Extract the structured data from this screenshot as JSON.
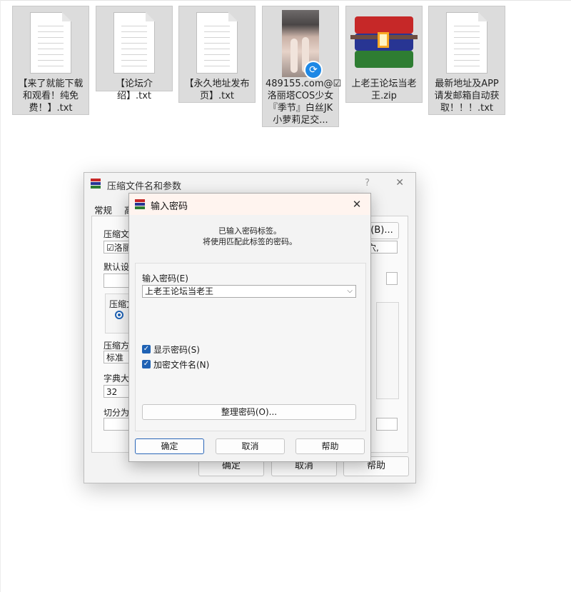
{
  "desktop": {
    "files": [
      {
        "caption": "【来了就能下载和观看！纯免费！】.txt",
        "icon": "text-file-icon"
      },
      {
        "caption": "【论坛介绍】.txt",
        "icon": "text-file-icon"
      },
      {
        "caption": "【永久地址发布页】.txt",
        "icon": "text-file-icon"
      },
      {
        "caption": "489155.com@☑洛丽塔COS少女『季节』白丝JK小萝莉足交...",
        "icon": "video-thumbnail-icon"
      },
      {
        "caption": "上老王论坛当老王.zip",
        "icon": "winrar-archive-icon"
      },
      {
        "caption": "最新地址及APP请发邮箱自动获取！！！.txt",
        "icon": "text-file-icon"
      }
    ]
  },
  "parent_dialog": {
    "title": "压缩文件名和参数",
    "help_glyph": "?",
    "close_glyph": "✕",
    "tab_general": "常规",
    "tab_next": "高",
    "label_archive_name": "压缩文件",
    "archive_name_value": "☑洛丽",
    "browse_button": "(B)...",
    "update_mode_value": "穴,",
    "label_default": "默认设置",
    "label_format": "压缩文",
    "label_method": "压缩方式",
    "method_value": "标准",
    "label_dict": "字典大小",
    "dict_value": "32",
    "label_split": "切分为分",
    "ok_button": "确定",
    "cancel_button": "取消",
    "help_button": "帮助"
  },
  "password_dialog": {
    "title": "输入密码",
    "info_line1": "已输入密码标签。",
    "info_line2": "将使用匹配此标签的密码。",
    "password_label": "输入密码(E)",
    "password_value": "上老王论坛当老王",
    "show_password_label": "显示密码(S)",
    "encrypt_filenames_label": "加密文件名(N)",
    "organize_button": "整理密码(O)...",
    "ok_button": "确定",
    "cancel_button": "取消",
    "help_button": "帮助",
    "close_glyph": "✕",
    "dropdown_glyph": "⌵"
  },
  "colors": {
    "accent": "#1f62b4",
    "modal_titlebar": "#fff4ef",
    "tile_selected": "#dcdcdc"
  }
}
